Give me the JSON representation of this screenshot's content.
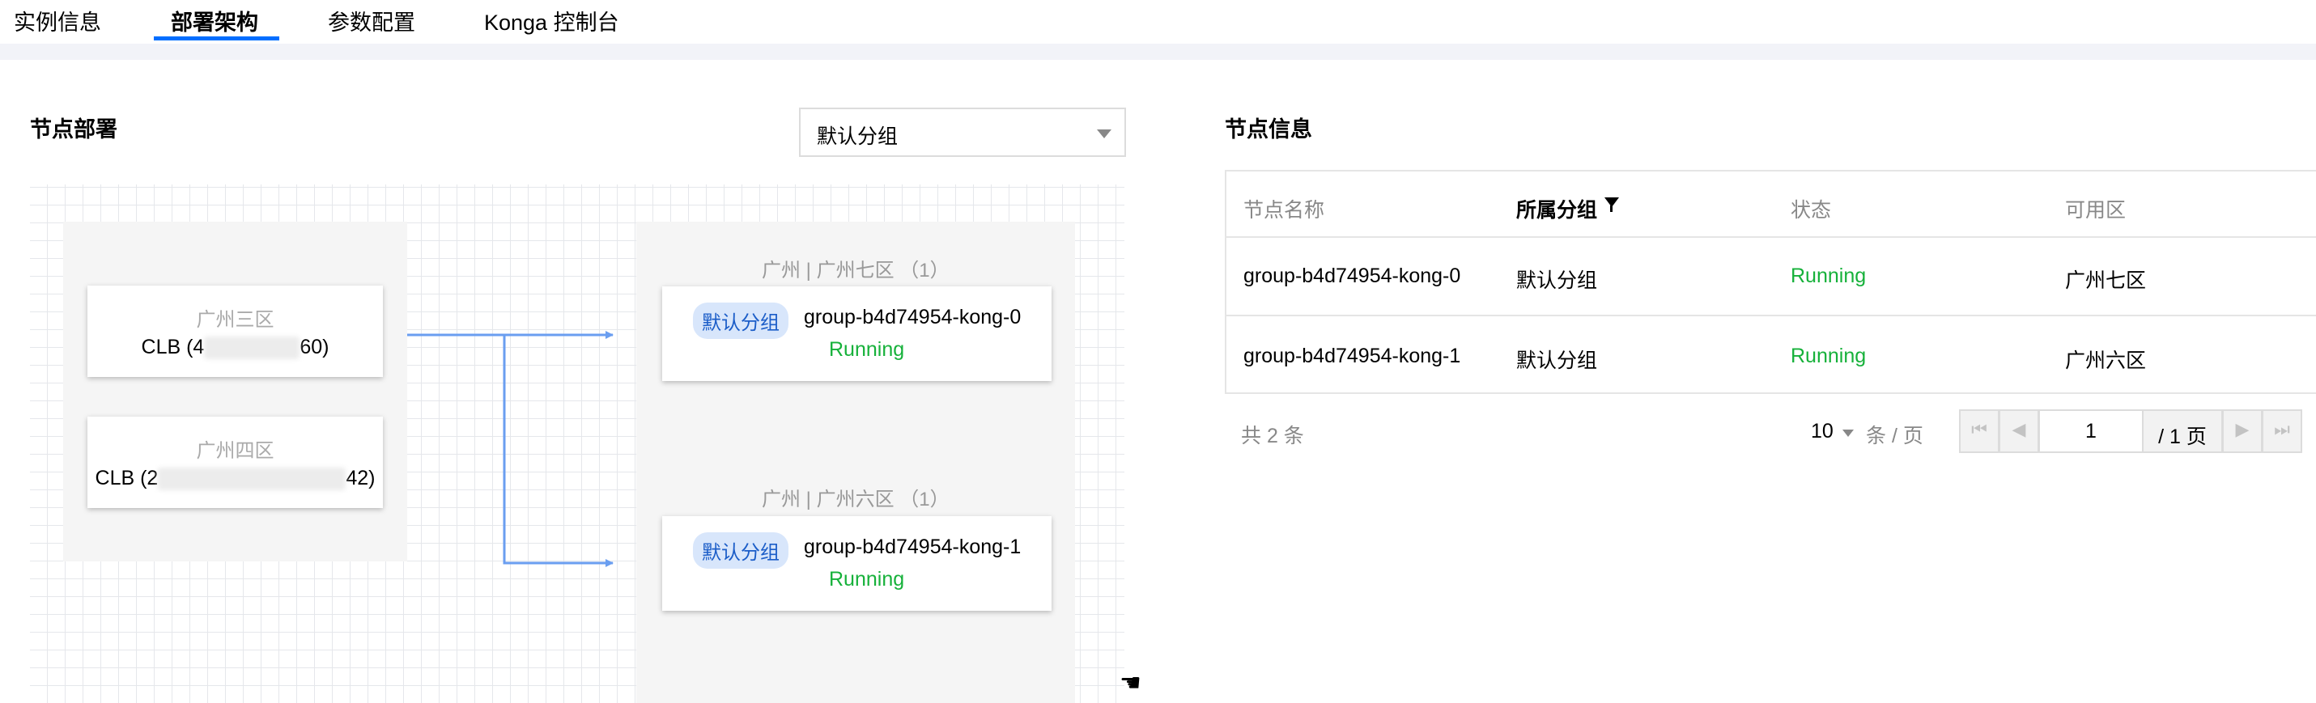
{
  "tabs": [
    {
      "label": "实例信息",
      "active": false
    },
    {
      "label": "部署架构",
      "active": true
    },
    {
      "label": "参数配置",
      "active": false
    },
    {
      "label": "Konga 控制台",
      "active": false
    }
  ],
  "deployment": {
    "title": "节点部署",
    "group_select": {
      "value": "默认分组"
    },
    "lb_nodes": [
      {
        "zone": "广州三区",
        "clb_prefix": "CLB (4",
        "clb_suffix": "60)"
      },
      {
        "zone": "广州四区",
        "clb_prefix": "CLB (2",
        "clb_suffix": "42)"
      }
    ],
    "zones": [
      {
        "label": "广州 | 广州七区 （1）",
        "tag": "默认分组",
        "instance": "group-b4d74954-kong-0",
        "status": "Running"
      },
      {
        "label": "广州 | 广州六区 （1）",
        "tag": "默认分组",
        "instance": "group-b4d74954-kong-1",
        "status": "Running"
      }
    ]
  },
  "node_info": {
    "title": "节点信息",
    "columns": [
      "节点名称",
      "所属分组",
      "状态",
      "可用区"
    ],
    "rows": [
      {
        "name": "group-b4d74954-kong-0",
        "group": "默认分组",
        "status": "Running",
        "zone": "广州七区"
      },
      {
        "name": "group-b4d74954-kong-1",
        "group": "默认分组",
        "status": "Running",
        "zone": "广州六区"
      }
    ],
    "pagination": {
      "total_text": "共 2 条",
      "page_size": "10",
      "per_page_text": "条 / 页",
      "current_page": "1",
      "total_pages_text": "/ 1 页"
    }
  },
  "colors": {
    "accent": "#006eff",
    "running": "#16b13a",
    "arrow": "#6a9ef0",
    "tag_bg": "#d8e6fb"
  }
}
